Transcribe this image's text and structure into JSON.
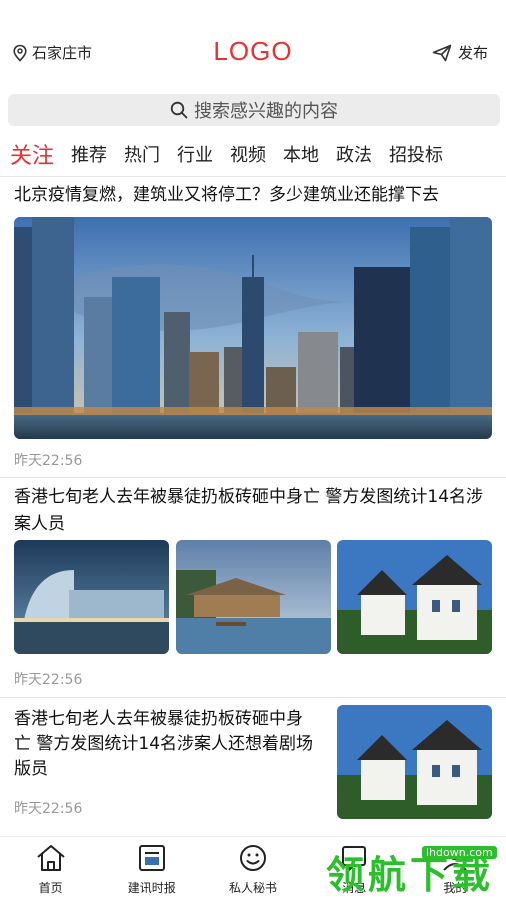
{
  "header": {
    "location": "石家庄市",
    "logo": "LOGO",
    "publish": "发布"
  },
  "search": {
    "placeholder": "搜索感兴趣的内容"
  },
  "tabs": [
    "关注",
    "推荐",
    "热门",
    "行业",
    "视频",
    "本地",
    "政法",
    "招投标"
  ],
  "articles": [
    {
      "title": "北京疫情复燃，建筑业又将停工？多少建筑业还能撑下去",
      "time": "昨天22:56"
    },
    {
      "title": "香港七旬老人去年被暴徒扔板砖砸中身亡   警方发图统计14名涉案人员",
      "time": "昨天22:56"
    },
    {
      "title": "香港七旬老人去年被暴徒扔板砖砸中身亡   警方发图统计14名涉案人还想着剧场版员",
      "time": "昨天22:56"
    }
  ],
  "bottom_nav": [
    "首页",
    "建讯时报",
    "私人秘书",
    "消息",
    "我的"
  ],
  "watermark": {
    "text": "领航下载",
    "url": "lhdown.com"
  },
  "colors": {
    "accent": "#e8312f",
    "watermark": "#2bbf2b"
  }
}
